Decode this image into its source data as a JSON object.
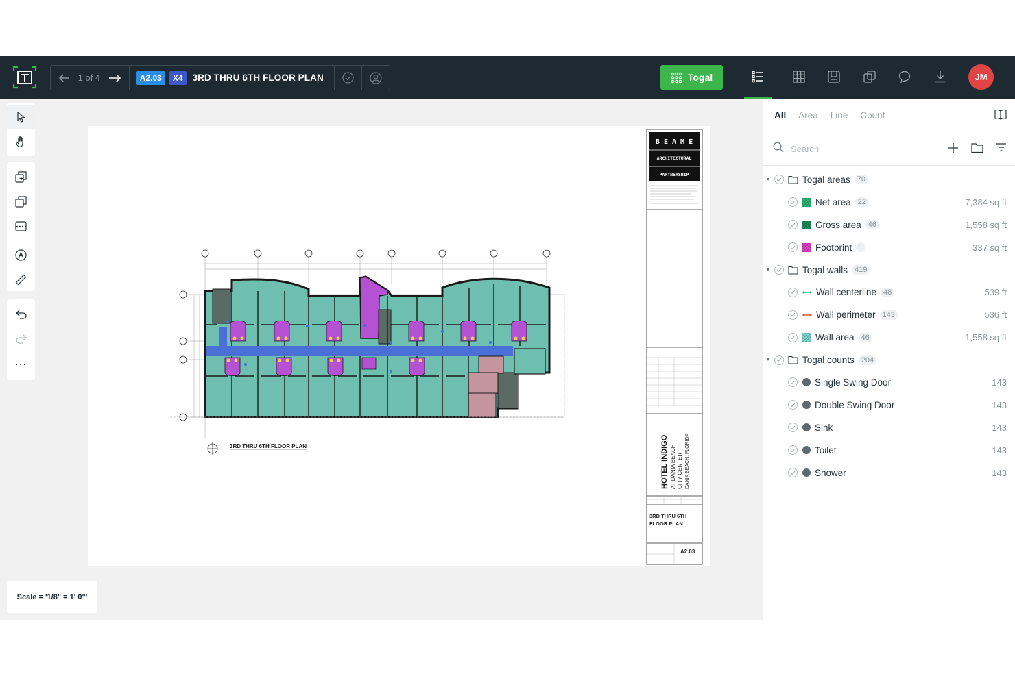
{
  "topbar": {
    "pager": "1 of 4",
    "sheet_code": "A2.03",
    "sheet_count": "X4",
    "sheet_title": "3RD THRU 6TH FLOOR PLAN",
    "togal_label": "Togal",
    "user_initials": "JM"
  },
  "canvas": {
    "scale_label": "Scale = '1/8\" = 1' 0\"'",
    "drawing_caption": "3RD THRU 6TH FLOOR PLAN",
    "title_block": {
      "firm_line1": "B E A M E",
      "firm_line2": "ARCHITECTURAL",
      "firm_line3": "PARTNERSHIP",
      "project_name": "HOTEL INDIGO",
      "project_line2": "AT DANIA BEACH",
      "project_line3": "CITY CENTER",
      "project_line4": "DANIA BEACH, FLORIDA",
      "sheet_title_line1": "3RD THRU 6TH",
      "sheet_title_line2": "FLOOR PLAN",
      "sheet_number": "A2.03"
    }
  },
  "panel": {
    "tabs": [
      "All",
      "Area",
      "Line",
      "Count"
    ],
    "search_placeholder": "Search",
    "groups": [
      {
        "label": "Togal areas",
        "count": "70",
        "items": [
          {
            "label": "Net area",
            "count": "22",
            "value": "7,384 sq ft",
            "color": "#2bb673",
            "kind": "area"
          },
          {
            "label": "Gross area",
            "count": "46",
            "value": "1,558 sq ft",
            "color": "#1e8a5a",
            "kind": "area"
          },
          {
            "label": "Footprint",
            "count": "1",
            "value": "337 sq ft",
            "color": "#e040c8",
            "kind": "area"
          }
        ]
      },
      {
        "label": "Togal walls",
        "count": "419",
        "items": [
          {
            "label": "Wall centerline",
            "count": "48",
            "value": "539 ft",
            "color": "#2bb673",
            "kind": "line"
          },
          {
            "label": "Wall perimeter",
            "count": "143",
            "value": "536 ft",
            "color": "#e8553d",
            "kind": "line"
          },
          {
            "label": "Wall area",
            "count": "46",
            "value": "1,558 sq ft",
            "color": "#7fd8d0",
            "kind": "area"
          }
        ]
      },
      {
        "label": "Togal counts",
        "count": "204",
        "items": [
          {
            "label": "Single Swing Door",
            "value": "143",
            "color": "#5f6a70",
            "kind": "count"
          },
          {
            "label": "Double Swing Door",
            "value": "143",
            "color": "#5f6a70",
            "kind": "count"
          },
          {
            "label": "Sink",
            "value": "143",
            "color": "#5f6a70",
            "kind": "count"
          },
          {
            "label": "Toilet",
            "value": "143",
            "color": "#5f6a70",
            "kind": "count"
          },
          {
            "label": "Shower",
            "value": "143",
            "color": "#5f6a70",
            "kind": "count"
          }
        ]
      }
    ]
  }
}
